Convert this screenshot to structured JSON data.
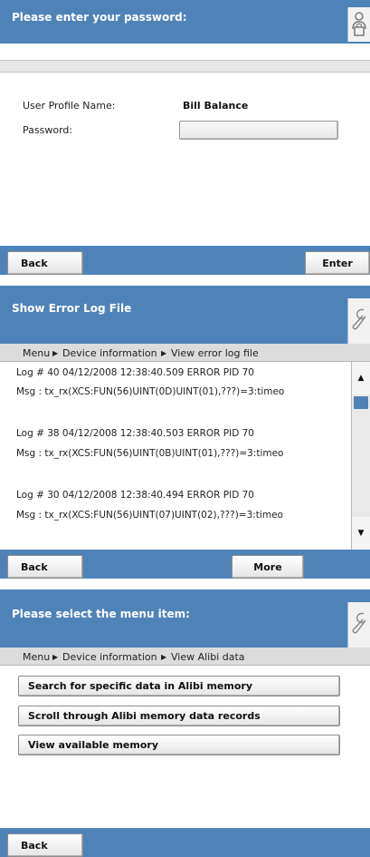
{
  "password_screen": {
    "title": "Please enter your password:",
    "logo_icon": "user-lock-icon",
    "profile_label": "User Profile Name:",
    "profile_value": "Bill Balance",
    "password_label": "Password:",
    "password_value": "",
    "back_label": "Back",
    "enter_label": "Enter"
  },
  "error_log_screen": {
    "title": "Show Error Log File",
    "logo_icon": "wrench-icon",
    "breadcrumb": {
      "menu": "Menu",
      "device_information": "Device information",
      "view_error_log": "View error log file"
    },
    "entries": [
      {
        "header": "Log # 40  04/12/2008  12:38:40.509  ERROR  PID  70",
        "message": "Msg : tx_rx(XCS:FUN(56)UINT(0D)UINT(01),???)=3:timeo"
      },
      {
        "header": "Log # 38  04/12/2008  12:38:40.503  ERROR  PID  70",
        "message": "Msg : tx_rx(XCS:FUN(56)UINT(0B)UINT(01),???)=3:timeo"
      },
      {
        "header": "Log # 30  04/12/2008  12:38:40.494  ERROR  PID  70",
        "message": "Msg : tx_rx(XCS:FUN(56)UINT(07)UINT(02),???)=3:timeo"
      }
    ],
    "scroll_up_icon": "triangle-up-icon",
    "scroll_down_icon": "triangle-down-icon",
    "back_label": "Back",
    "more_label": "More"
  },
  "alibi_screen": {
    "title": "Please select the menu item:",
    "logo_icon": "wrench-icon",
    "breadcrumb": {
      "menu": "Menu",
      "device_information": "Device information",
      "view_alibi": "View Alibi data"
    },
    "menu_items": [
      "Search for specific data in Alibi memory",
      "Scroll through Alibi memory data records",
      "View available memory"
    ],
    "back_label": "Back"
  },
  "colors": {
    "header_blue": "#4f83b8",
    "breadcrumb_gray": "#dcdcdc"
  }
}
